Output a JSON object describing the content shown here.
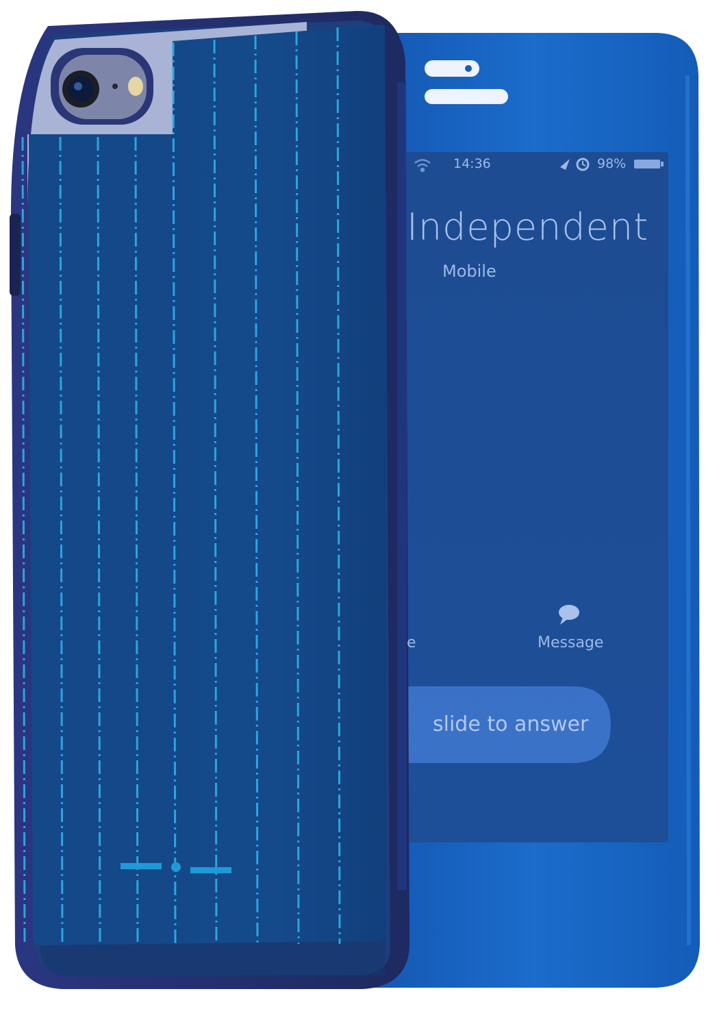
{
  "screen": {
    "status_time": "14:36",
    "status_battery": "98%",
    "caller_name": "Independent",
    "caller_subtitle": "Mobile",
    "message_label": "Message",
    "partial_label": "e",
    "slide_label": "slide to answer"
  },
  "colors": {
    "case_blue": "#14498a",
    "stripe_cyan": "#2aa6e0",
    "cover_blue": "#1a66c4",
    "frame_navy": "#232f6b"
  },
  "icons": [
    "wifi-icon",
    "location-icon",
    "alarm-icon",
    "battery-icon",
    "message-icon",
    "camera-lens-icon",
    "flash-icon"
  ]
}
